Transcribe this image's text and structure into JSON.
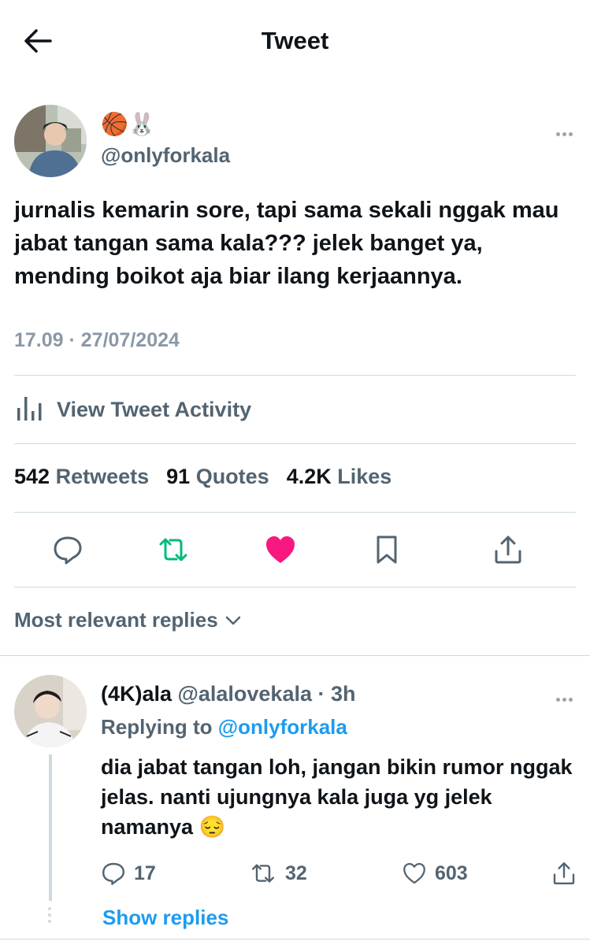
{
  "header": {
    "title": "Tweet"
  },
  "tweet": {
    "display_name_emoji": "🏀🐰",
    "handle": "@onlyforkala",
    "text": "jurnalis kemarin sore, tapi sama sekali nggak mau jabat tangan sama kala??? jelek banget ya, mending boikot aja biar ilang kerjaannya.",
    "timestamp": "17.09 · 27/07/2024",
    "activity_label": "View Tweet Activity",
    "stats": {
      "retweets_count": "542",
      "retweets_label": "Retweets",
      "quotes_count": "91",
      "quotes_label": "Quotes",
      "likes_count": "4.2K",
      "likes_label": "Likes"
    }
  },
  "replies_sort": {
    "label": "Most relevant replies"
  },
  "reply": {
    "name": "(4K)ala",
    "meta": "@alalovekala · 3h",
    "replying_prefix": "Replying to",
    "replying_handle": "@onlyforkala",
    "text": "dia jabat tangan loh, jangan bikin rumor nggak jelas. nanti ujungnya kala juga yg jelek namanya 😔",
    "replies_count": "17",
    "retweets_count": "32",
    "likes_count": "603",
    "show_replies_label": "Show replies"
  },
  "colors": {
    "accent": "#1d9bf0",
    "retweet_green": "#00ba7c",
    "like_pink": "#f91880",
    "muted": "#536471"
  },
  "icons": [
    "back-arrow-icon",
    "more-icon",
    "bar-chart-icon",
    "reply-icon",
    "retweet-icon",
    "heart-icon",
    "bookmark-icon",
    "share-icon",
    "chevron-down-icon"
  ]
}
